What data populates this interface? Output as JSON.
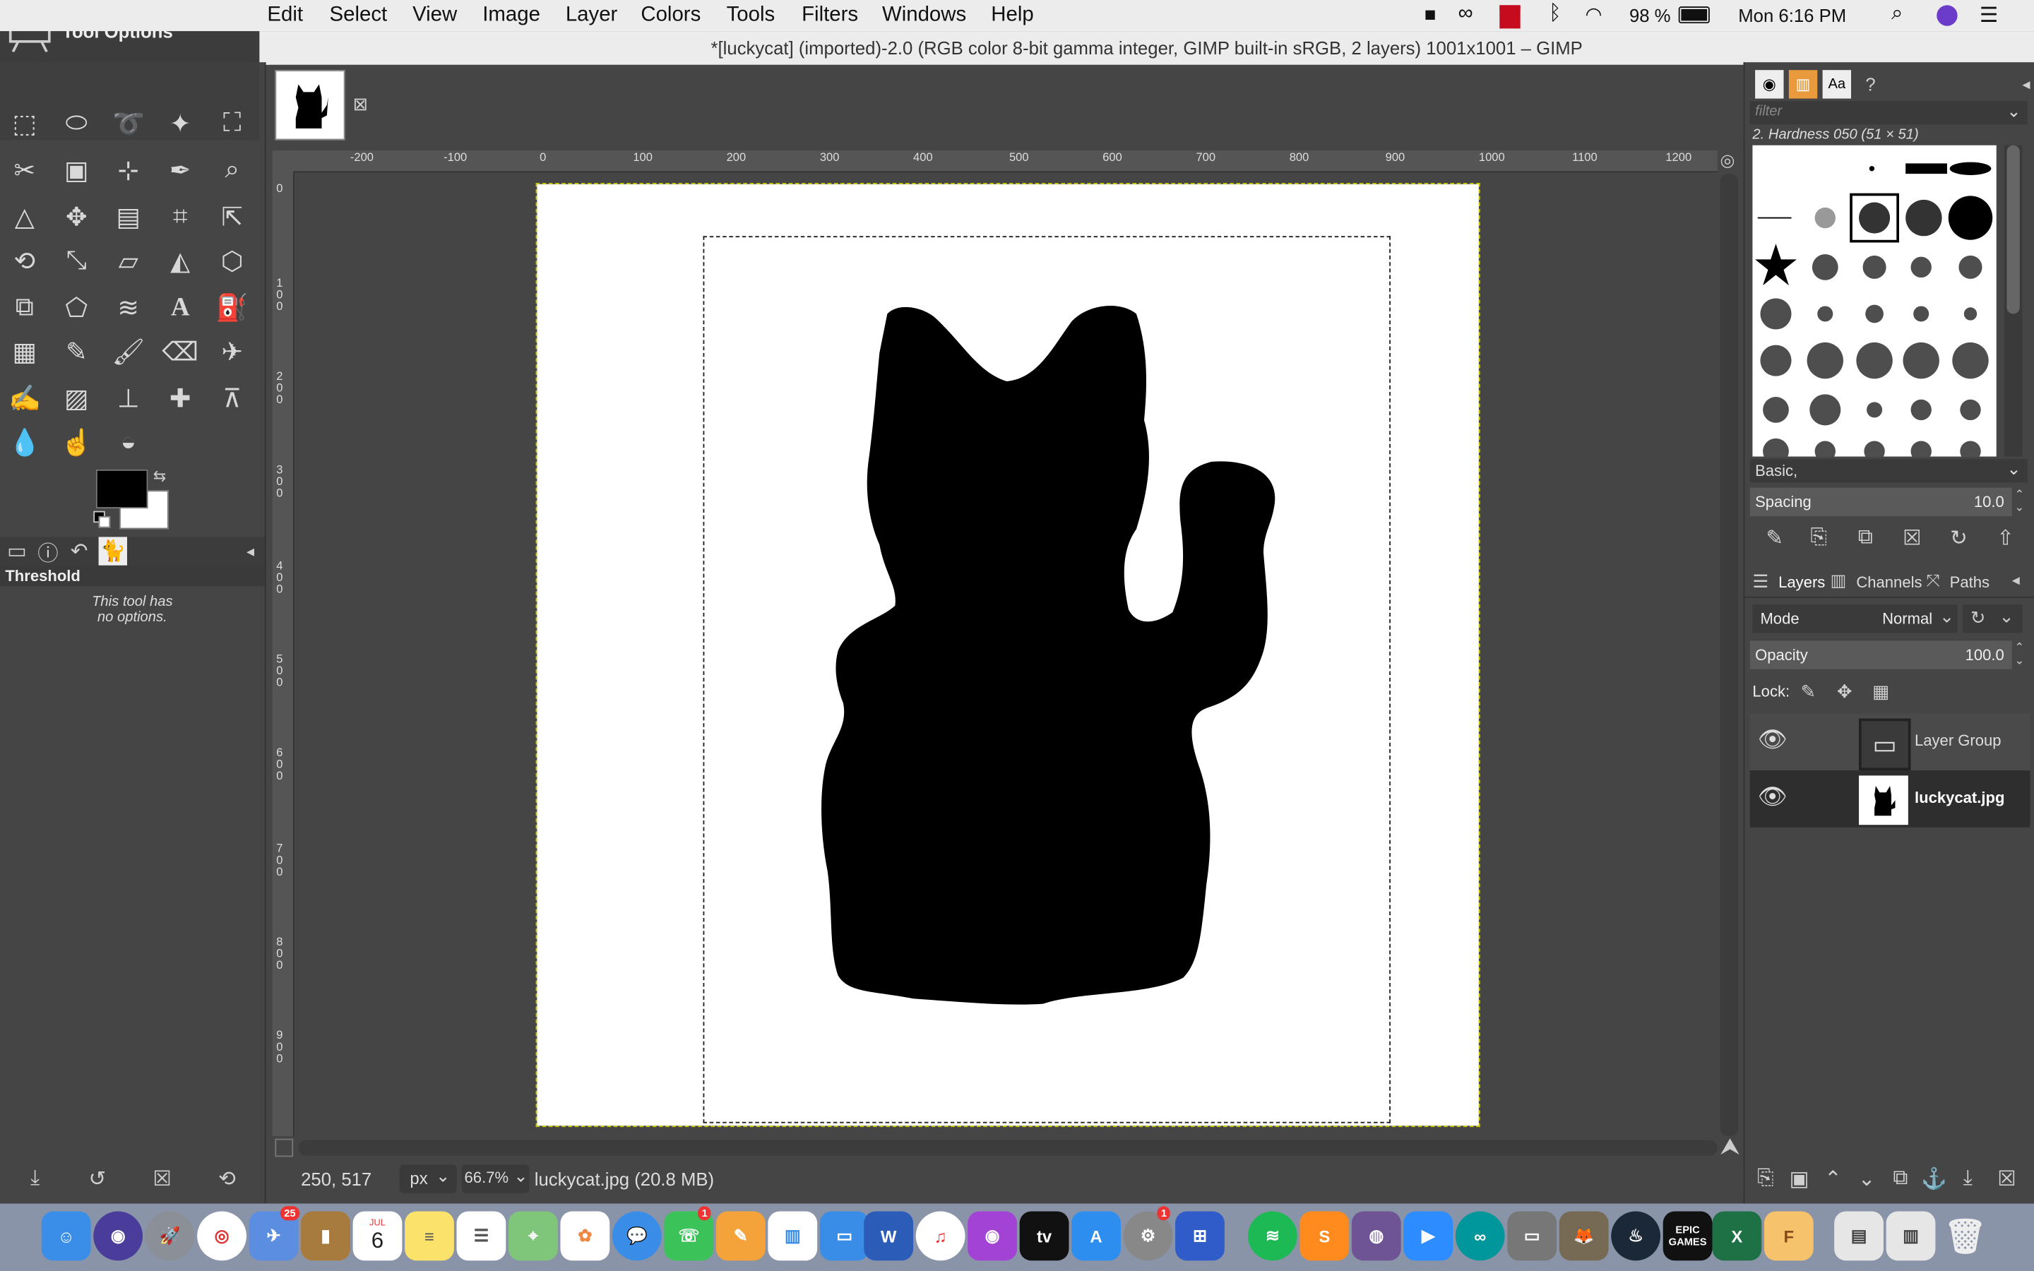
{
  "menubar": {
    "items": [
      "Edit",
      "Select",
      "View",
      "Image",
      "Layer",
      "Colors",
      "Tools",
      "Filters",
      "Windows",
      "Help"
    ],
    "battery": "98 %",
    "clock": "Mon 6:16 PM"
  },
  "tool_options": {
    "title": "Tool Options",
    "tool_name": "Threshold",
    "message": "This tool has\nno options."
  },
  "window": {
    "title": "*[luckycat] (imported)-2.0 (RGB color 8-bit gamma integer, GIMP built-in sRGB, 2 layers) 1001x1001 – GIMP"
  },
  "ruler": {
    "h_labels": [
      "-200",
      "-100",
      "0",
      "100",
      "200",
      "300",
      "400",
      "500",
      "600",
      "700",
      "800",
      "900",
      "1000",
      "1100",
      "1200"
    ],
    "v_labels": [
      "0",
      "100",
      "200",
      "300",
      "400",
      "500",
      "600",
      "700",
      "800",
      "900"
    ]
  },
  "status": {
    "coords": "250, 517",
    "unit": "px",
    "zoom": "66.7%",
    "file_info": "luckycat.jpg (20.8 MB)"
  },
  "brushes": {
    "filter_placeholder": "filter",
    "brush_name": "2. Hardness 050 (51 × 51)",
    "preset": "Basic,",
    "spacing_label": "Spacing",
    "spacing_value": "10.0"
  },
  "layers": {
    "tabs": [
      "Layers",
      "Channels",
      "Paths"
    ],
    "mode_label": "Mode",
    "mode_value": "Normal",
    "opacity_label": "Opacity",
    "opacity_value": "100.0",
    "lock_label": "Lock:",
    "items": [
      {
        "name": "Layer Group"
      },
      {
        "name": "luckycat.jpg"
      }
    ]
  },
  "dock": {
    "calendar_month": "JUL",
    "calendar_day": "6",
    "badges": {
      "photos": "25",
      "messages": "1",
      "prefs": "1"
    },
    "epic_label": "EPIC GAMES"
  },
  "colors": {
    "accent_yellow": "#c8c800",
    "fg": "#000000",
    "bg": "#ffffff"
  }
}
